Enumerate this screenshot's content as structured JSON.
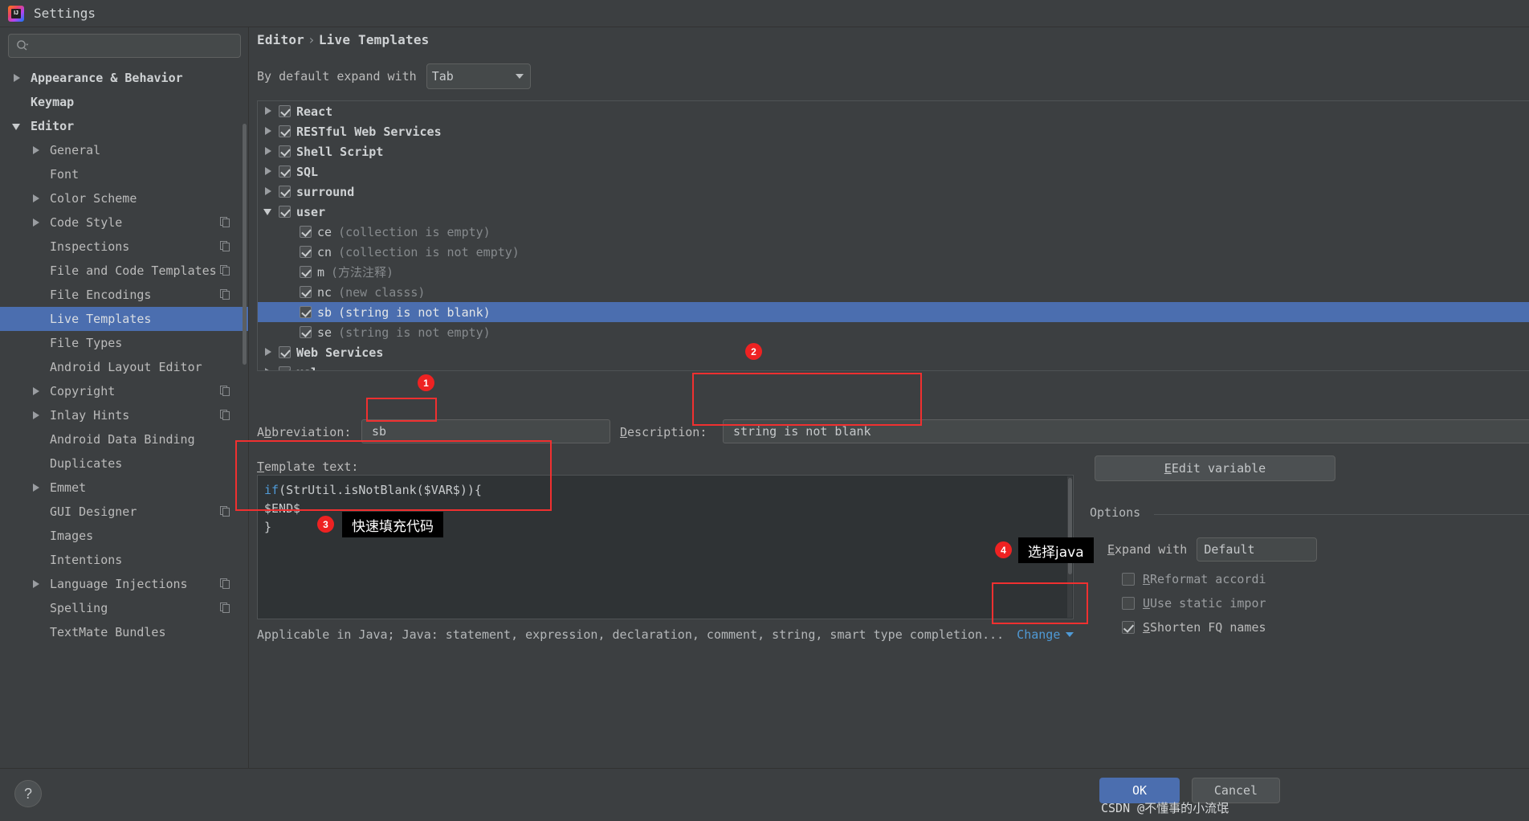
{
  "window": {
    "title": "Settings",
    "logo_icon": "intellij-idea-logo"
  },
  "sidebar": {
    "search_placeholder": "",
    "search_icon": "search-icon",
    "items": [
      {
        "label": "Appearance & Behavior",
        "indent": 0,
        "arrow": "right",
        "bold": true,
        "selected": false,
        "copy": false
      },
      {
        "label": "Keymap",
        "indent": 0,
        "arrow": "none",
        "bold": true,
        "selected": false,
        "copy": false
      },
      {
        "label": "Editor",
        "indent": 0,
        "arrow": "down",
        "bold": true,
        "selected": false,
        "copy": false
      },
      {
        "label": "General",
        "indent": 1,
        "arrow": "right",
        "bold": false,
        "selected": false,
        "copy": false
      },
      {
        "label": "Font",
        "indent": 1,
        "arrow": "none",
        "bold": false,
        "selected": false,
        "copy": false
      },
      {
        "label": "Color Scheme",
        "indent": 1,
        "arrow": "right",
        "bold": false,
        "selected": false,
        "copy": false
      },
      {
        "label": "Code Style",
        "indent": 1,
        "arrow": "right",
        "bold": false,
        "selected": false,
        "copy": true
      },
      {
        "label": "Inspections",
        "indent": 1,
        "arrow": "none",
        "bold": false,
        "selected": false,
        "copy": true
      },
      {
        "label": "File and Code Templates",
        "indent": 1,
        "arrow": "none",
        "bold": false,
        "selected": false,
        "copy": true
      },
      {
        "label": "File Encodings",
        "indent": 1,
        "arrow": "none",
        "bold": false,
        "selected": false,
        "copy": true
      },
      {
        "label": "Live Templates",
        "indent": 1,
        "arrow": "none",
        "bold": false,
        "selected": true,
        "copy": false
      },
      {
        "label": "File Types",
        "indent": 1,
        "arrow": "none",
        "bold": false,
        "selected": false,
        "copy": false
      },
      {
        "label": "Android Layout Editor",
        "indent": 1,
        "arrow": "none",
        "bold": false,
        "selected": false,
        "copy": false
      },
      {
        "label": "Copyright",
        "indent": 1,
        "arrow": "right",
        "bold": false,
        "selected": false,
        "copy": true
      },
      {
        "label": "Inlay Hints",
        "indent": 1,
        "arrow": "right",
        "bold": false,
        "selected": false,
        "copy": true
      },
      {
        "label": "Android Data Binding",
        "indent": 1,
        "arrow": "none",
        "bold": false,
        "selected": false,
        "copy": false
      },
      {
        "label": "Duplicates",
        "indent": 1,
        "arrow": "none",
        "bold": false,
        "selected": false,
        "copy": false
      },
      {
        "label": "Emmet",
        "indent": 1,
        "arrow": "right",
        "bold": false,
        "selected": false,
        "copy": false
      },
      {
        "label": "GUI Designer",
        "indent": 1,
        "arrow": "none",
        "bold": false,
        "selected": false,
        "copy": true
      },
      {
        "label": "Images",
        "indent": 1,
        "arrow": "none",
        "bold": false,
        "selected": false,
        "copy": false
      },
      {
        "label": "Intentions",
        "indent": 1,
        "arrow": "none",
        "bold": false,
        "selected": false,
        "copy": false
      },
      {
        "label": "Language Injections",
        "indent": 1,
        "arrow": "right",
        "bold": false,
        "selected": false,
        "copy": true
      },
      {
        "label": "Spelling",
        "indent": 1,
        "arrow": "none",
        "bold": false,
        "selected": false,
        "copy": true
      },
      {
        "label": "TextMate Bundles",
        "indent": 1,
        "arrow": "none",
        "bold": false,
        "selected": false,
        "copy": false
      }
    ]
  },
  "breadcrumb": {
    "root": "Editor",
    "separator": "›",
    "leaf": "Live Templates"
  },
  "expand": {
    "label": "By default expand with",
    "value": "Tab"
  },
  "templates": [
    {
      "label": "React",
      "group": true,
      "arrow": "right",
      "checked": true,
      "desc": "",
      "selected": false
    },
    {
      "label": "RESTful Web Services",
      "group": true,
      "arrow": "right",
      "checked": true,
      "desc": "",
      "selected": false
    },
    {
      "label": "Shell Script",
      "group": true,
      "arrow": "right",
      "checked": true,
      "desc": "",
      "selected": false
    },
    {
      "label": "SQL",
      "group": true,
      "arrow": "right",
      "checked": true,
      "desc": "",
      "selected": false
    },
    {
      "label": "surround",
      "group": true,
      "arrow": "right",
      "checked": true,
      "desc": "",
      "selected": false
    },
    {
      "label": "user",
      "group": true,
      "arrow": "down",
      "checked": true,
      "desc": "",
      "selected": false
    },
    {
      "label": "ce",
      "group": false,
      "arrow": "none",
      "checked": true,
      "desc": "(collection is empty)",
      "selected": false
    },
    {
      "label": "cn",
      "group": false,
      "arrow": "none",
      "checked": true,
      "desc": "(collection is not empty)",
      "selected": false
    },
    {
      "label": "m",
      "group": false,
      "arrow": "none",
      "checked": true,
      "desc": "(方法注释)",
      "selected": false
    },
    {
      "label": "nc",
      "group": false,
      "arrow": "none",
      "checked": true,
      "desc": "(new classs)",
      "selected": false
    },
    {
      "label": "sb",
      "group": false,
      "arrow": "none",
      "checked": true,
      "desc": "(string is not blank)",
      "selected": true
    },
    {
      "label": "se",
      "group": false,
      "arrow": "none",
      "checked": true,
      "desc": "(string is not empty)",
      "selected": false
    },
    {
      "label": "Web Services",
      "group": true,
      "arrow": "right",
      "checked": true,
      "desc": "",
      "selected": false
    },
    {
      "label": "xsl",
      "group": true,
      "arrow": "right",
      "checked": true,
      "desc": "",
      "selected": false
    }
  ],
  "fields": {
    "abbreviation_label": "Abbreviation:",
    "abbreviation_value": "sb",
    "description_label": "Description:",
    "description_value": "string is not blank",
    "template_text_label": "Template text:",
    "template_text_lines": [
      "if(StrUtil.isNotBlank($VAR$)){",
      "$END$",
      "}"
    ],
    "template_keyword": "if"
  },
  "options": {
    "edit_variables_button": "Edit variable",
    "legend": "Options",
    "expand_with_label": "Expand with",
    "expand_with_value": "Default",
    "checkboxes": [
      {
        "label": "Reformat accordi",
        "checked": false,
        "enabled": false
      },
      {
        "label": "Use static impor",
        "checked": false,
        "enabled": false
      },
      {
        "label": "Shorten FQ names",
        "checked": true,
        "enabled": true
      }
    ]
  },
  "applicable": {
    "text": "Applicable in Java; Java: statement, expression, declaration, comment, string, smart type completion...",
    "change_link": "Change",
    "change_icon": "chevron-down-icon"
  },
  "bottom": {
    "help_label": "?",
    "ok_label": "OK",
    "cancel_label": "Cancel",
    "watermark": "CSDN @不懂事的小流氓"
  },
  "annotations": [
    {
      "id": "1",
      "tip": ""
    },
    {
      "id": "2",
      "tip": ""
    },
    {
      "id": "3",
      "tip": "快速填充代码"
    },
    {
      "id": "4",
      "tip": "选择java"
    }
  ],
  "colors": {
    "accent": "#4b6eaf",
    "annotation": "#ee2222",
    "link": "#4f9ad6",
    "panel": "#3c3f41",
    "editor_bg": "#2f3335"
  }
}
